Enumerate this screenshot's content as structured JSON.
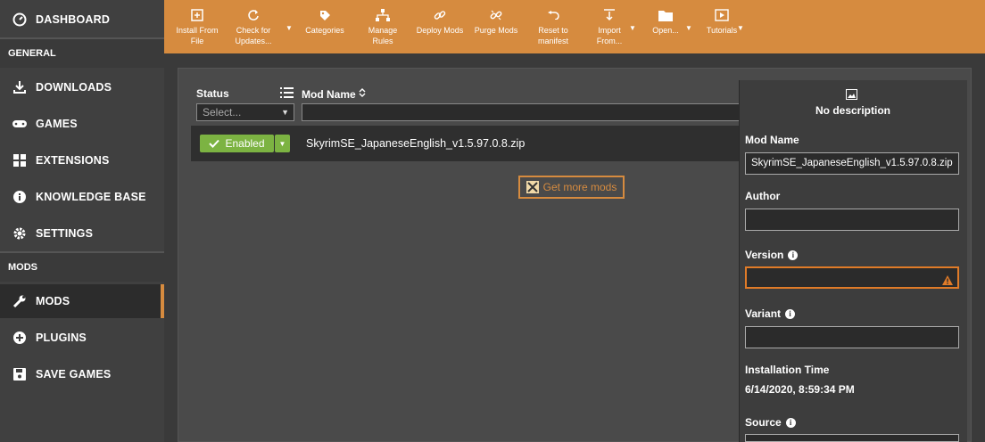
{
  "sidebar": {
    "dashboard": "DASHBOARD",
    "section_general": "GENERAL",
    "downloads": "DOWNLOADS",
    "games": "GAMES",
    "extensions": "EXTENSIONS",
    "knowledge_base": "KNOWLEDGE BASE",
    "settings": "SETTINGS",
    "section_mods": "MODS",
    "mods": "MODS",
    "plugins": "PLUGINS",
    "save_games": "SAVE GAMES"
  },
  "toolbar": {
    "install_from_file": [
      "Install From",
      "File"
    ],
    "check_updates": [
      "Check for",
      "Updates..."
    ],
    "categories": "Categories",
    "manage_rules": [
      "Manage",
      "Rules"
    ],
    "deploy_mods": "Deploy Mods",
    "purge_mods": "Purge Mods",
    "reset_manifest": [
      "Reset to",
      "manifest"
    ],
    "import_from": [
      "Import",
      "From..."
    ],
    "open": "Open...",
    "tutorials": "Tutorials"
  },
  "table": {
    "status_header": "Status",
    "modname_header": "Mod Name",
    "status_select_placeholder": "Select...",
    "rows": [
      {
        "status": "Enabled",
        "name": "SkyrimSE_JapaneseEnglish_v1.5.97.0.8.zip"
      }
    ],
    "get_more": "Get more mods"
  },
  "details": {
    "no_description": "No description",
    "mod_name_label": "Mod Name",
    "mod_name_value": "SkyrimSE_JapaneseEnglish_v1.5.97.0.8.zip",
    "author_label": "Author",
    "author_value": "",
    "version_label": "Version",
    "version_value": "",
    "variant_label": "Variant",
    "variant_value": "",
    "install_time_label": "Installation Time",
    "install_time_value": "6/14/2020, 8:59:34 PM",
    "source_label": "Source"
  },
  "colors": {
    "accent": "#d68b3f",
    "enabled": "#7cb342",
    "warning": "#e07b28"
  }
}
